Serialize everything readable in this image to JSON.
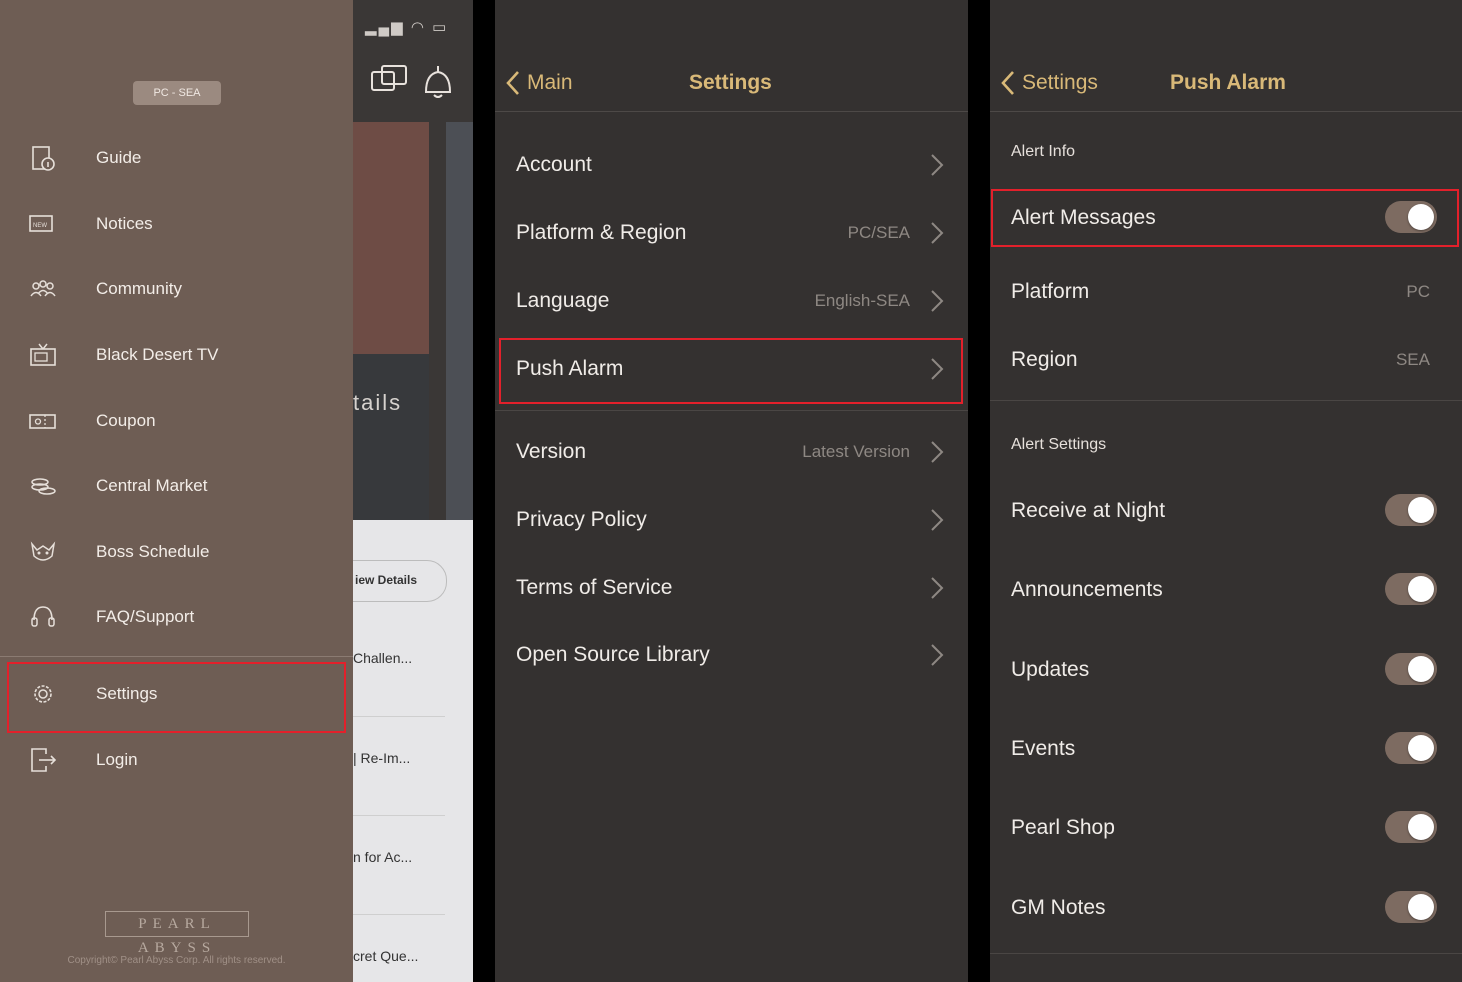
{
  "screen1": {
    "background_app": {
      "partial_details": "tails",
      "view_details_button": "iew Details",
      "list_items": [
        "Challen...",
        "| Re-Im...",
        "n for Ac...",
        "cret Que..."
      ]
    },
    "drawer": {
      "badge": "PC - SEA",
      "menu": [
        {
          "label": "Guide",
          "icon": "guide-icon"
        },
        {
          "label": "Notices",
          "icon": "notices-icon"
        },
        {
          "label": "Community",
          "icon": "community-icon"
        },
        {
          "label": "Black Desert TV",
          "icon": "tv-icon"
        },
        {
          "label": "Coupon",
          "icon": "coupon-icon"
        },
        {
          "label": "Central Market",
          "icon": "market-icon"
        },
        {
          "label": "Boss Schedule",
          "icon": "boss-icon"
        },
        {
          "label": "FAQ/Support",
          "icon": "headset-icon"
        },
        {
          "label": "Settings",
          "icon": "gear-icon"
        },
        {
          "label": "Login",
          "icon": "login-icon"
        }
      ],
      "logo": "PEARL ABYSS",
      "copyright": "Copyright© Pearl Abyss Corp. All rights reserved."
    }
  },
  "screen2": {
    "back_label": "Main",
    "title": "Settings",
    "rows": [
      {
        "label": "Account",
        "value": ""
      },
      {
        "label": "Platform & Region",
        "value": "PC/SEA"
      },
      {
        "label": "Language",
        "value": "English-SEA"
      },
      {
        "label": "Push Alarm",
        "value": ""
      },
      {
        "label": "Version",
        "value": "Latest Version"
      },
      {
        "label": "Privacy Policy",
        "value": ""
      },
      {
        "label": "Terms of Service",
        "value": ""
      },
      {
        "label": "Open Source Library",
        "value": ""
      }
    ]
  },
  "screen3": {
    "back_label": "Settings",
    "title": "Push Alarm",
    "alert_info_header": "Alert Info",
    "alert_messages": {
      "label": "Alert Messages",
      "enabled": true
    },
    "platform": {
      "label": "Platform",
      "value": "PC"
    },
    "region": {
      "label": "Region",
      "value": "SEA"
    },
    "alert_settings_header": "Alert Settings",
    "settings": [
      {
        "label": "Receive at Night",
        "enabled": true
      },
      {
        "label": "Announcements",
        "enabled": true
      },
      {
        "label": "Updates",
        "enabled": true
      },
      {
        "label": "Events",
        "enabled": true
      },
      {
        "label": "Pearl Shop",
        "enabled": true
      },
      {
        "label": "GM Notes",
        "enabled": true
      }
    ]
  },
  "colors": {
    "accent_gold": "#d9b978",
    "drawer_bg": "#6e5d54",
    "panel_bg": "#343130",
    "highlight_red": "#e3202b",
    "toggle_on": "#7d6b61"
  }
}
